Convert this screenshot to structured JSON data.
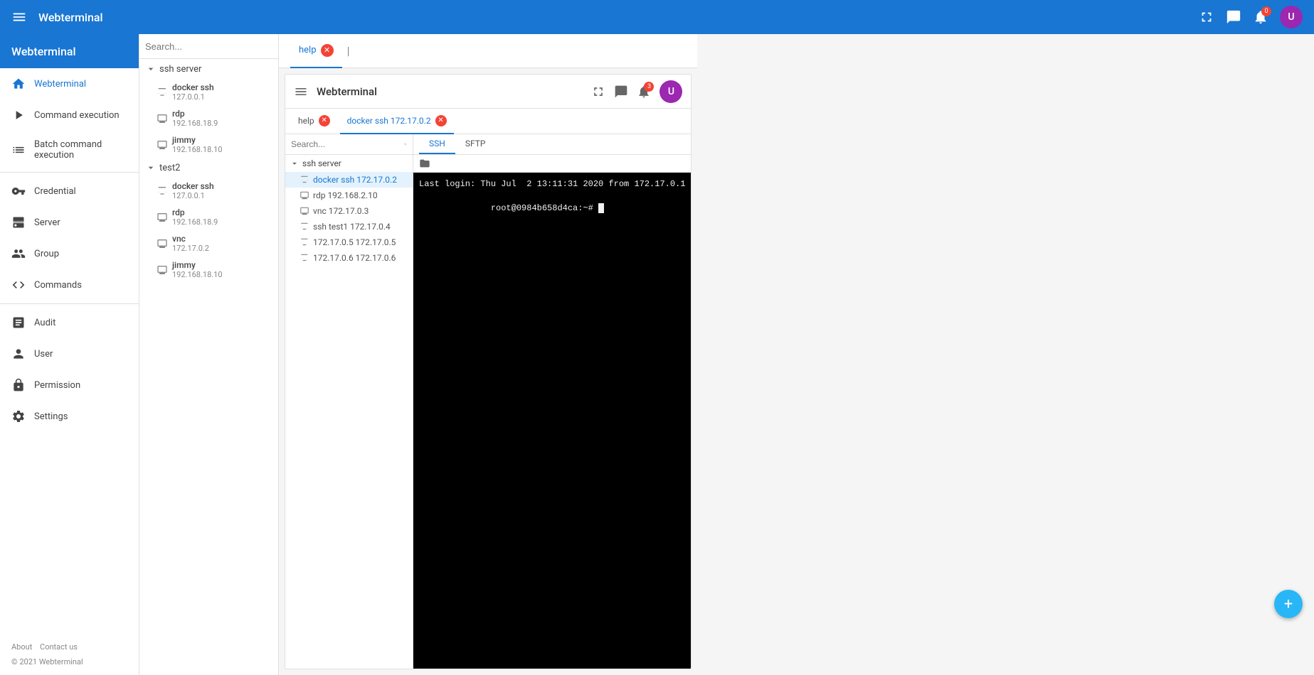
{
  "app": {
    "title": "Webterminal",
    "brand": "Webterminal"
  },
  "topbar": {
    "title": "Webterminal",
    "notifications_count": "0",
    "messages_badge": ""
  },
  "sidebar": {
    "webterminal_label": "Webterminal",
    "nav_items": [
      {
        "id": "home",
        "label": "Webterminal",
        "icon": "home"
      },
      {
        "id": "command-execution",
        "label": "Command execution",
        "icon": "play"
      },
      {
        "id": "batch-command",
        "label": "Batch command execution",
        "icon": "list"
      },
      {
        "id": "credential",
        "label": "Credential",
        "icon": "key"
      },
      {
        "id": "server",
        "label": "Server",
        "icon": "server"
      },
      {
        "id": "group",
        "label": "Group",
        "icon": "group"
      },
      {
        "id": "commands",
        "label": "Commands",
        "icon": "code"
      },
      {
        "id": "audit",
        "label": "Audit",
        "icon": "audit"
      },
      {
        "id": "user",
        "label": "User",
        "icon": "user"
      },
      {
        "id": "permission",
        "label": "Permission",
        "icon": "lock"
      },
      {
        "id": "settings",
        "label": "Settings",
        "icon": "settings"
      }
    ],
    "footer": {
      "about": "About",
      "contact": "Contact us",
      "copyright": "© 2021 Webterminal"
    }
  },
  "server_tree": {
    "search_placeholder": "Search...",
    "groups": [
      {
        "name": "ssh server",
        "expanded": true,
        "items": [
          {
            "name": "docker ssh",
            "addr": "127.0.0.1",
            "type": "ssh"
          },
          {
            "name": "rdp",
            "addr": "192.168.18.9",
            "type": "rdp"
          },
          {
            "name": "jimmy",
            "addr": "192.168.18.10",
            "type": "rdp"
          }
        ]
      },
      {
        "name": "test2",
        "expanded": true,
        "items": [
          {
            "name": "docker ssh",
            "addr": "127.0.0.1",
            "type": "ssh"
          },
          {
            "name": "rdp",
            "addr": "192.168.18.9",
            "type": "rdp"
          },
          {
            "name": "vnc",
            "addr": "172.17.0.2",
            "type": "vnc"
          },
          {
            "name": "jimmy",
            "addr": "192.168.18.10",
            "type": "rdp"
          }
        ]
      }
    ]
  },
  "outer_tabs": [
    {
      "id": "help",
      "label": "help",
      "active": true,
      "closeable": true
    }
  ],
  "inner": {
    "header_title": "Webterminal",
    "inner_badge": "3",
    "tabs": [
      {
        "id": "help",
        "label": "help",
        "active": false,
        "closeable": true
      },
      {
        "id": "docker-ssh",
        "label": "docker ssh 172.17.0.2",
        "active": true,
        "closeable": true
      }
    ],
    "ssh_sftp_tabs": [
      {
        "id": "ssh",
        "label": "SSH",
        "active": true
      },
      {
        "id": "sftp",
        "label": "SFTP",
        "active": false
      }
    ],
    "server_tree": {
      "search_placeholder": "Search...",
      "groups": [
        {
          "name": "ssh server",
          "expanded": true,
          "items": [
            {
              "name": "docker ssh 172.17.0.2",
              "active": true
            },
            {
              "name": "rdp 192.168.2.10"
            },
            {
              "name": "vnc 172.17.0.3"
            },
            {
              "name": "ssh test1 172.17.0.4"
            },
            {
              "name": "172.17.0.5 172.17.0.5"
            },
            {
              "name": "172.17.0.6 172.17.0.6"
            }
          ]
        }
      ]
    },
    "terminal_lines": [
      "Last login: Thu Jul  2 13:11:31 2020 from 172.17.0.1",
      "root@0984b658d4ca:~# "
    ]
  },
  "fab": {
    "label": "+"
  },
  "cursor": {
    "symbol": "▌"
  }
}
